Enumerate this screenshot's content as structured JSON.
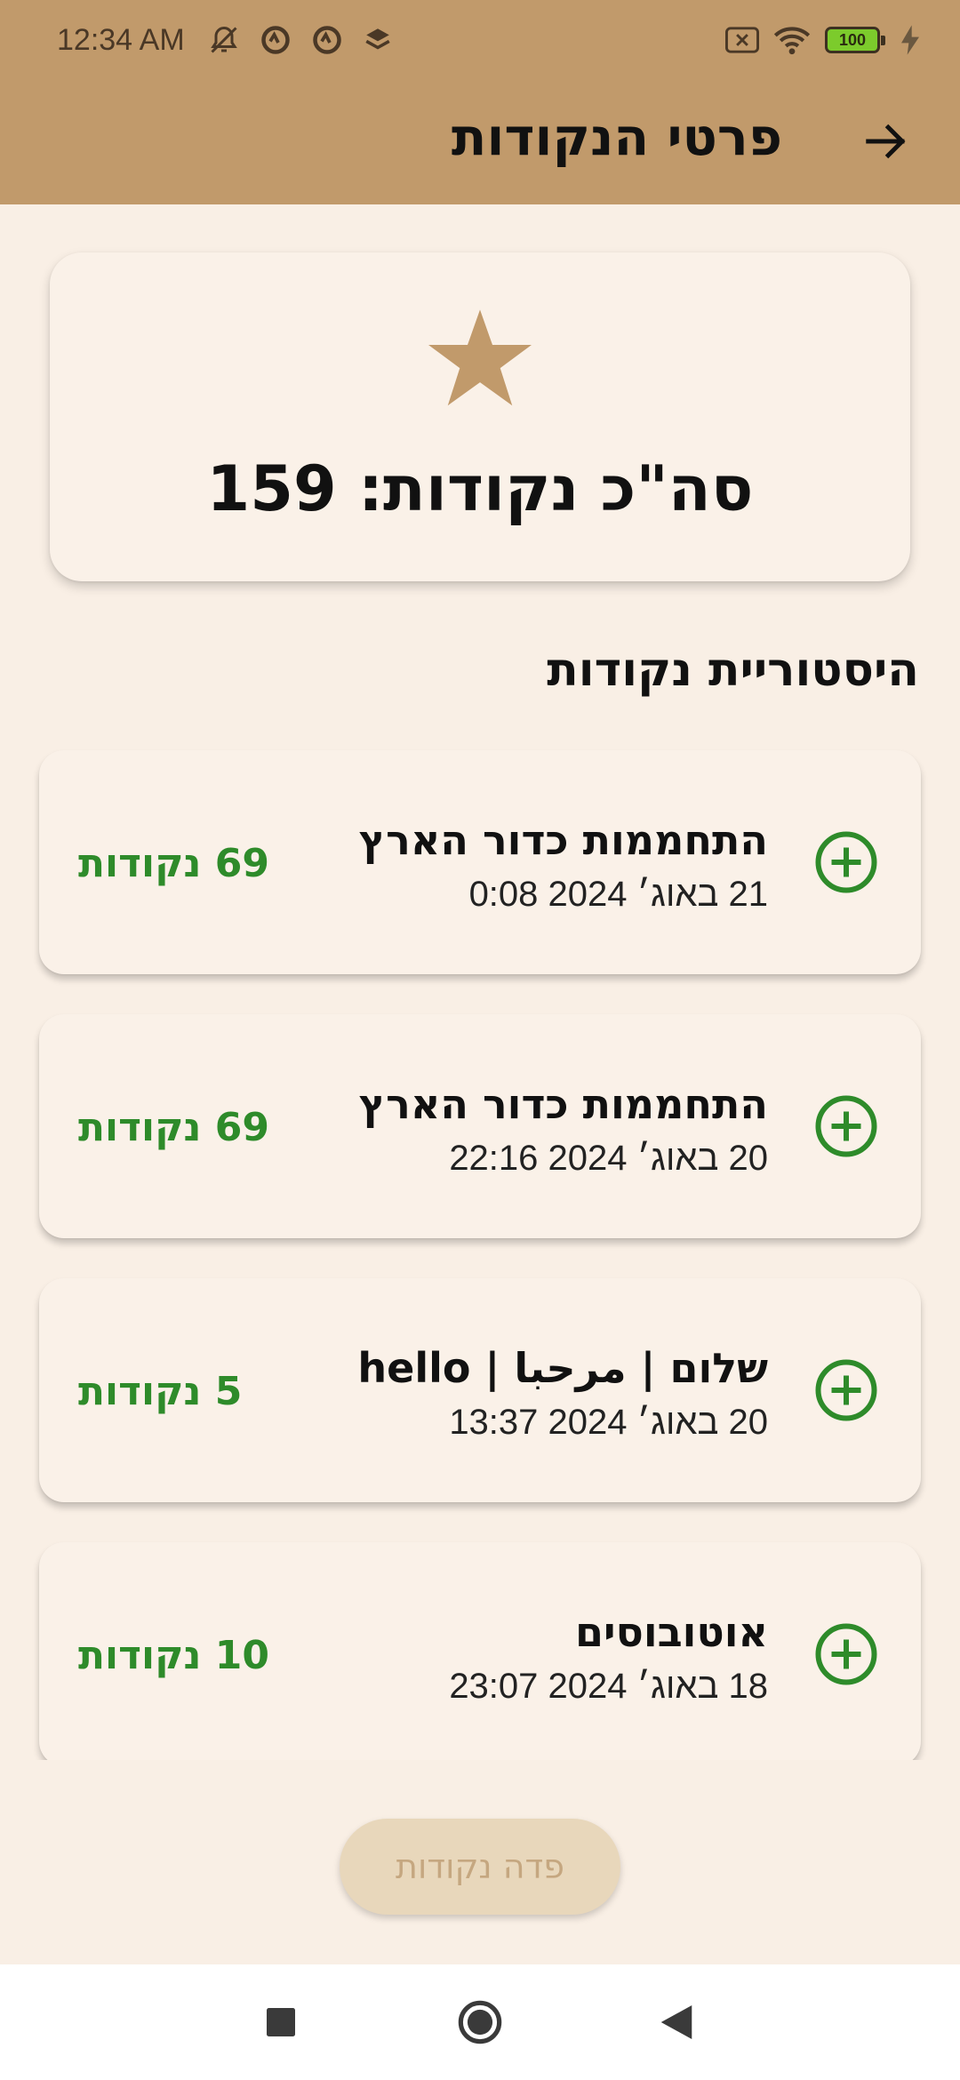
{
  "status_bar": {
    "time": "12:34 AM",
    "battery_level": "100",
    "icons": [
      "muted-bell-icon",
      "app-notification-icon",
      "app-notification-icon",
      "layers-icon",
      "no-sim-icon",
      "wifi-icon",
      "battery-icon",
      "charging-bolt-icon"
    ]
  },
  "app_bar": {
    "title": "פרטי הנקודות",
    "back_icon": "arrow-right-icon",
    "color": "#c19a6b"
  },
  "summary": {
    "total_label": "סה\"כ נקודות: 159",
    "star_color": "#c19a6b"
  },
  "history": {
    "title": "היסטוריית נקודות",
    "items": [
      {
        "name": "התחממות כדור הארץ",
        "date": "21 באוג׳ 2024 0:08",
        "points": "69 נקודות"
      },
      {
        "name": "התחממות כדור הארץ",
        "date": "20 באוג׳ 2024 22:16",
        "points": "69 נקודות"
      },
      {
        "name": "שלום | مرحبا | hello",
        "date": "20 באוג׳ 2024 13:37",
        "points": "5 נקודות"
      },
      {
        "name": "אוטובוסים",
        "date": "18 באוג׳ 2024 23:07",
        "points": "10 נקודות"
      }
    ],
    "points_color": "#2e8b2a"
  },
  "redeem_button": {
    "label": "פדה נקודות"
  },
  "nav_bar": {
    "icons": [
      "recents-square-icon",
      "home-circle-icon",
      "back-triangle-icon"
    ]
  }
}
